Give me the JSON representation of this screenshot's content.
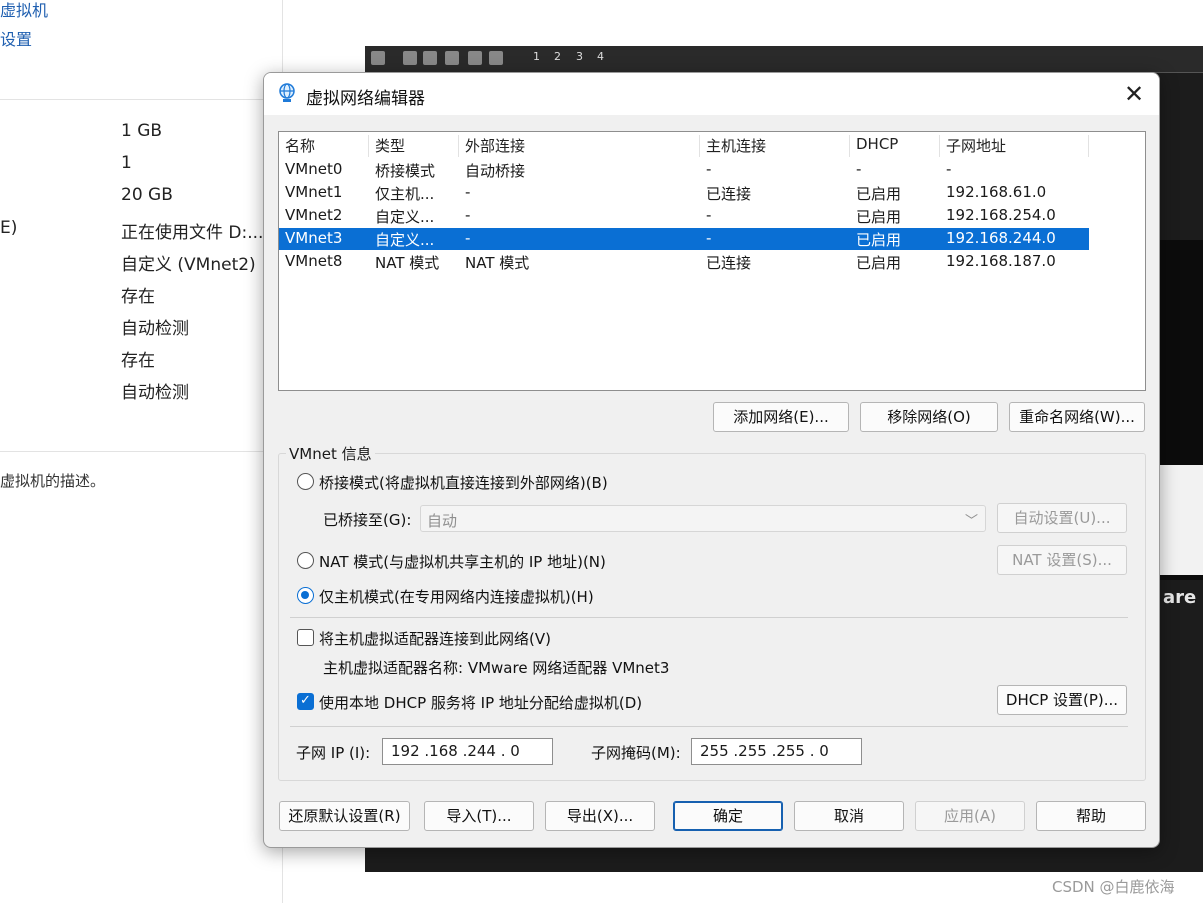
{
  "background": {
    "links": [
      "虚拟机",
      "设置"
    ],
    "rows": [
      {
        "key": "",
        "value": "1 GB"
      },
      {
        "key": "",
        "value": "1"
      },
      {
        "key": "",
        "value": "20 GB"
      },
      {
        "key": "E)",
        "value": "正在使用文件 D:..."
      },
      {
        "key": "",
        "value": "自定义 (VMnet2)"
      },
      {
        "key": "",
        "value": "存在"
      },
      {
        "key": "",
        "value": "自动检测"
      },
      {
        "key": "",
        "value": "存在"
      },
      {
        "key": "",
        "value": "自动检测"
      }
    ],
    "description": "虚拟机的描述。",
    "console_tabs": [
      "1",
      "2",
      "3",
      "4"
    ],
    "console_text": "are",
    "watermark": "CSDN @白鹿依海"
  },
  "dialog": {
    "title": "虚拟网络编辑器",
    "close": "✕",
    "columns": [
      "名称",
      "类型",
      "外部连接",
      "主机连接",
      "DHCP",
      "子网地址"
    ],
    "rows": [
      [
        "VMnet0",
        "桥接模式",
        "自动桥接",
        "-",
        "-",
        "-"
      ],
      [
        "VMnet1",
        "仅主机...",
        "-",
        "已连接",
        "已启用",
        "192.168.61.0"
      ],
      [
        "VMnet2",
        "自定义...",
        "-",
        "-",
        "已启用",
        "192.168.254.0"
      ],
      [
        "VMnet3",
        "自定义...",
        "-",
        "-",
        "已启用",
        "192.168.244.0"
      ],
      [
        "VMnet8",
        "NAT 模式",
        "NAT 模式",
        "已连接",
        "已启用",
        "192.168.187.0"
      ]
    ],
    "selected_row": 3,
    "add_network": "添加网络(E)...",
    "remove_network": "移除网络(O)",
    "rename_network": "重命名网络(W)...",
    "group_title": "VMnet 信息",
    "bridged_label": "桥接模式(将虚拟机直接连接到外部网络)(B)",
    "bridged_to_label": "已桥接至(G):",
    "bridged_to_value": "自动",
    "auto_settings": "自动设置(U)...",
    "nat_label": "NAT 模式(与虚拟机共享主机的 IP 地址)(N)",
    "nat_settings": "NAT 设置(S)...",
    "hostonly_label": "仅主机模式(在专用网络内连接虚拟机)(H)",
    "connect_adapter_label": "将主机虚拟适配器连接到此网络(V)",
    "adapter_name": "主机虚拟适配器名称: VMware 网络适配器 VMnet3",
    "dhcp_label": "使用本地 DHCP 服务将 IP 地址分配给虚拟机(D)",
    "dhcp_settings": "DHCP 设置(P)...",
    "subnet_ip_label": "子网 IP (I):",
    "subnet_ip": "192 .168 .244 .  0",
    "subnet_mask_label": "子网掩码(M):",
    "subnet_mask": "255 .255 .255 .  0",
    "restore_defaults": "还原默认设置(R)",
    "import": "导入(T)...",
    "export": "导出(X)...",
    "ok": "确定",
    "cancel": "取消",
    "apply": "应用(A)",
    "help": "帮助"
  }
}
